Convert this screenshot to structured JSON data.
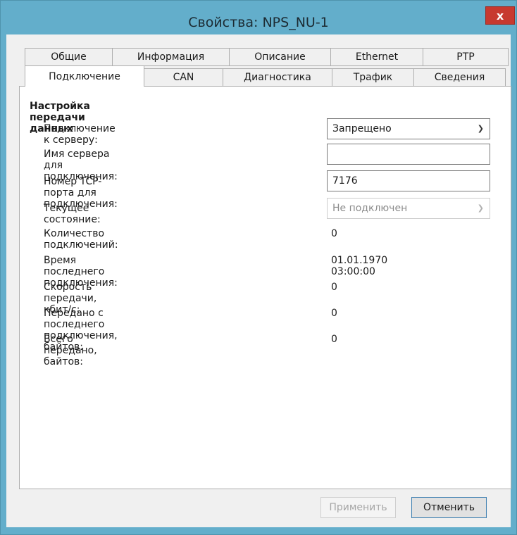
{
  "window": {
    "title": "Свойства: NPS_NU-1",
    "close_label": "x"
  },
  "tabs_row_back": [
    "Общие",
    "Информация",
    "Описание",
    "Ethernet",
    "PTP"
  ],
  "tabs_row_front": [
    "Подключение",
    "CAN",
    "Диагностика",
    "Трафик",
    "Сведения"
  ],
  "active_tab": "Подключение",
  "section": {
    "title": "Настройка передачи данных"
  },
  "fields": {
    "server_connection": {
      "label": "Подключение к серверу:",
      "value": "Запрещено"
    },
    "server_name": {
      "label": "Имя сервера для подключения:",
      "value": ""
    },
    "tcp_port": {
      "label": "Номер TCP-порта для подключения:",
      "value": "7176"
    },
    "current_state": {
      "label": "Текущее состояние:",
      "value": "Не подключен"
    },
    "connection_count": {
      "label": "Количество подключений:",
      "value": "0"
    },
    "last_connection_time": {
      "label": "Время последнего подключения:",
      "value": "01.01.1970 03:00:00"
    },
    "transfer_speed": {
      "label": "Скорость передачи, кбит/с:",
      "value": "0"
    },
    "sent_since_last": {
      "label": "Передано с последнего подключения, байтов:",
      "value": "0"
    },
    "total_sent": {
      "label": "Всего передано, байтов:",
      "value": "0"
    }
  },
  "buttons": {
    "apply": "Применить",
    "cancel": "Отменить"
  },
  "colors": {
    "title_bar": "#63aecb",
    "close_button": "#c7392f",
    "default_button_border": "#3c7fb1"
  }
}
